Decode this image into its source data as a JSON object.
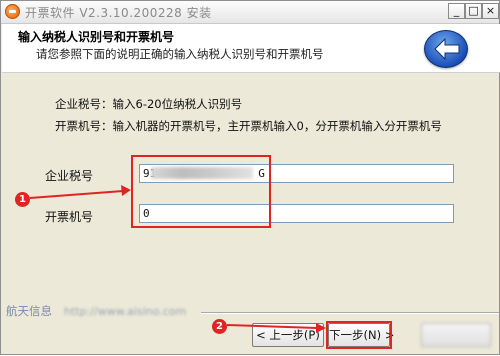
{
  "window": {
    "title": "开票软件  V2.3.10.200228 安装"
  },
  "header": {
    "title": "输入纳税人识别号和开票机号",
    "subtitle": "请您参照下面的说明正确的输入纳税人识别号和开票机号",
    "back_icon": "back-arrow-icon"
  },
  "instructions": {
    "tax_id": "企业税号：输入6-20位纳税人识别号",
    "machine_no": "开票机号：输入机器的开票机号，主开票机输入0，分开票机输入分开票机号"
  },
  "form": {
    "tax_id_label": "企业税号",
    "tax_id_value_start": "91",
    "tax_id_value_end": "G",
    "machine_no_label": "开票机号",
    "machine_no_value": "0"
  },
  "footer": {
    "company": "航天信息",
    "url": "http://www.aisino.com",
    "prev_label": "< 上一步(P)",
    "next_label": "下一步(N) >"
  },
  "annotations": {
    "marker_1": "1",
    "marker_2": "2",
    "color": "#e02424"
  }
}
